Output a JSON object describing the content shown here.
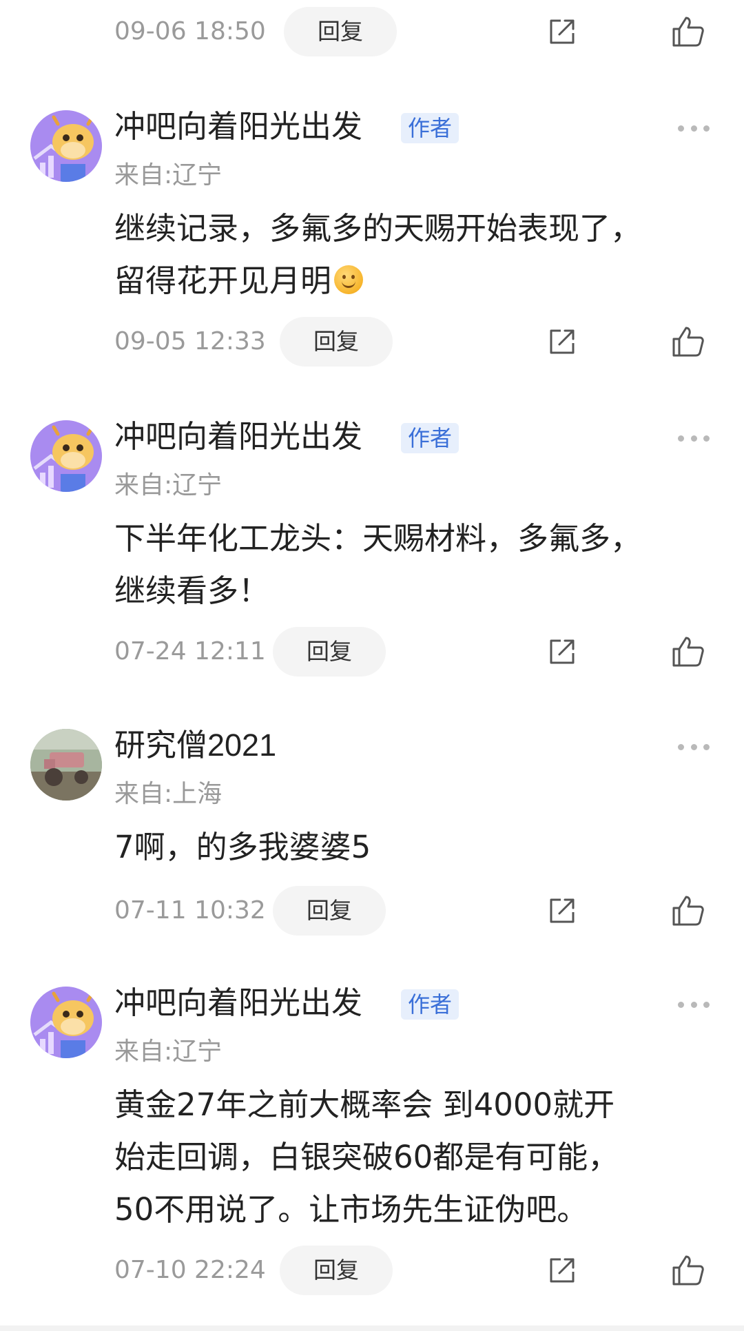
{
  "icons": {
    "share": "share-icon",
    "like": "thumbs-up-icon",
    "more": "more-dots-icon"
  },
  "colors": {
    "author_tag_text": "#3a6fd8",
    "author_tag_bg": "#e7effc",
    "timestamp": "#9a9a9a",
    "reply_bg": "#f4f4f4"
  },
  "top_meta": {
    "timestamp": "09-06 18:50",
    "reply_label": "回复"
  },
  "comments": [
    {
      "username": "冲吧向着阳光出发",
      "author_tag": "作者",
      "location": "来自:辽宁",
      "text": "继续记录，多氟多的天赐开始表现了，\n留得花开见月明",
      "has_emoji": true,
      "timestamp": "09-05 12:33",
      "reply_label": "回复"
    },
    {
      "username": "冲吧向着阳光出发",
      "author_tag": "作者",
      "location": "来自:辽宁",
      "text": "下半年化工龙头：天赐材料，多氟多，\n继续看多！",
      "timestamp": "07-24 12:11",
      "reply_label": "回复"
    },
    {
      "username": "研究僧2021",
      "location": "来自:上海",
      "text": "7啊，的多我婆婆5",
      "timestamp": "07-11 10:32",
      "reply_label": "回复"
    },
    {
      "username": "冲吧向着阳光出发",
      "author_tag": "作者",
      "location": "来自:辽宁",
      "text": "黄金27年之前大概率会 到4000就开\n始走回调，白银突破60都是有可能，\n50不用说了。让市场先生证伪吧。",
      "timestamp": "07-10 22:24",
      "reply_label": "回复"
    }
  ]
}
